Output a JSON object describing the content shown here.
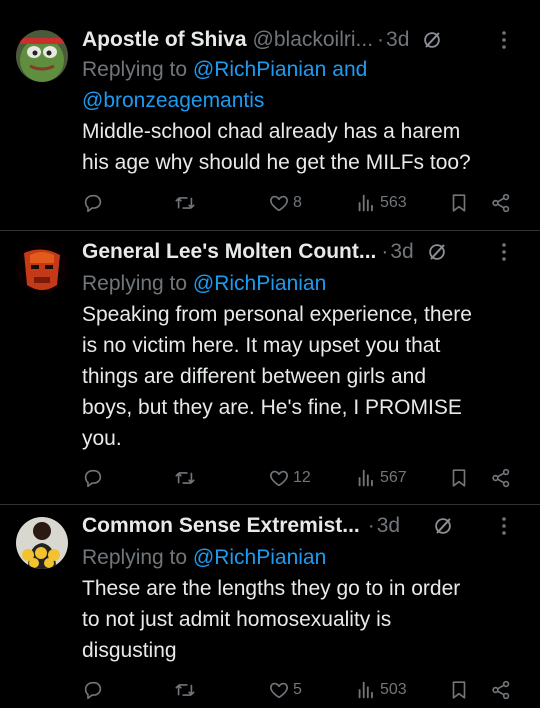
{
  "colors": {
    "background": "#000000",
    "text": "#e7e9ea",
    "muted": "#71767b",
    "link": "#1d9bf0",
    "divider": "#2f3336"
  },
  "tweets": [
    {
      "name": "Apostle of Shiva",
      "handle": "@blackoilri...",
      "dot": "·",
      "time": "3d",
      "reply_prefix": "Replying to",
      "reply_to_1": "@RichPianian",
      "reply_and": "and",
      "reply_to_2": "@bronzeagemantis",
      "lines": [
        "Middle-school chad already has a harem",
        "his age why should he get the MILFs too?"
      ],
      "likes": "8",
      "views": "563",
      "avatar_icon": "frog-avatar"
    },
    {
      "name": "General Lee's Molten Count...",
      "dot": "·",
      "time": "3d",
      "reply_prefix": "Replying to",
      "reply_to_1": "@RichPianian",
      "lines": [
        "Speaking from personal experience, there",
        "is no victim here. It may upset you that",
        "things are different between girls and",
        "boys, but they are. He's fine, I PROMISE",
        "you."
      ],
      "likes": "12",
      "views": "567",
      "avatar_icon": "red-mask-avatar"
    },
    {
      "name": "Common Sense Extremist...",
      "dot": "·",
      "time": "3d",
      "reply_prefix": "Replying to",
      "reply_to_1": "@RichPianian",
      "lines": [
        "These are the lengths they go to in order",
        "to not just admit homosexuality is",
        "disgusting"
      ],
      "likes": "5",
      "views": "503",
      "avatar_icon": "badges-avatar"
    }
  ]
}
